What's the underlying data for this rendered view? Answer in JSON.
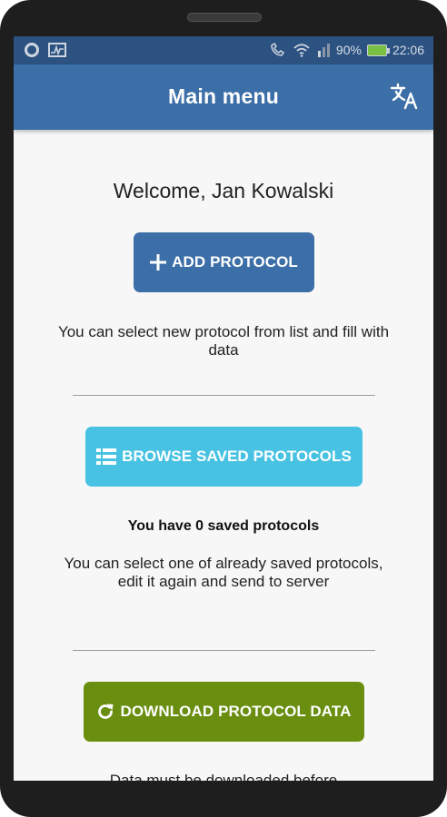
{
  "status_bar": {
    "battery": "90%",
    "time": "22:06"
  },
  "app_bar": {
    "title": "Main menu",
    "translate_icon": "translate-icon"
  },
  "main": {
    "welcome": "Welcome, Jan Kowalski",
    "add_button": {
      "label": "ADD PROTOCOL",
      "icon": "plus-icon",
      "color": "#3c6ea7"
    },
    "add_description": "You can select new protocol from list and fill with data",
    "browse_button": {
      "label": "BROWSE SAVED PROTOCOLS",
      "icon": "list-icon",
      "color": "#48c2e2"
    },
    "saved_count": "You have 0 saved protocols",
    "browse_description": "You can select one of already saved protocols, edit it again and send to server",
    "download_button": {
      "label": "DOWNLOAD PROTOCOL DATA",
      "icon": "refresh-icon",
      "color": "#6a8e10"
    },
    "download_description": "Data must be downloaded before"
  }
}
